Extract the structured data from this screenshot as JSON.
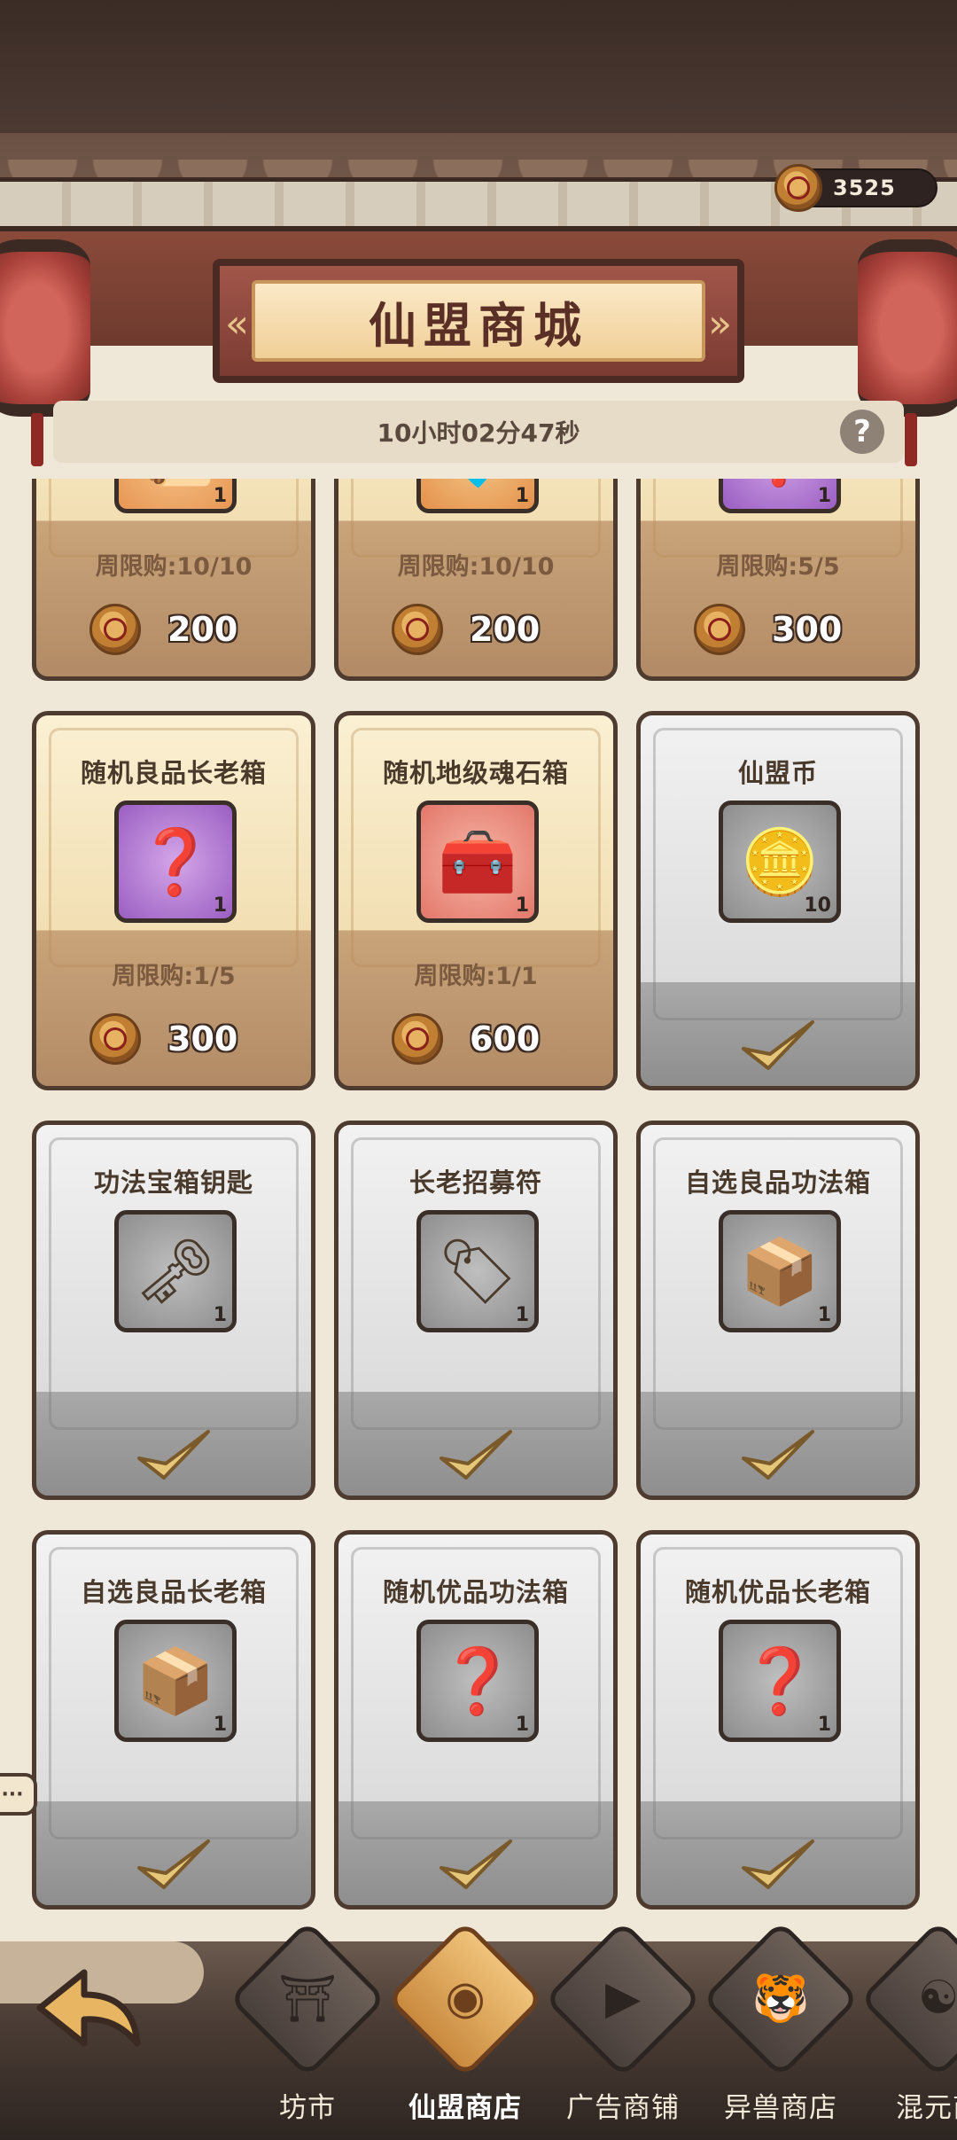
{
  "header": {
    "currency_amount": "3525",
    "title": "仙盟商城",
    "timer": "10小时02分47秒"
  },
  "shop": {
    "items": [
      {
        "name": "",
        "limit": "周限购:10/10",
        "price": "200",
        "qty": "1",
        "icon": "scroll-item-icon",
        "state": "available",
        "color": "orange"
      },
      {
        "name": "",
        "limit": "周限购:10/10",
        "price": "200",
        "qty": "1",
        "icon": "spirit-stone-icon",
        "state": "available",
        "color": "blue"
      },
      {
        "name": "",
        "limit": "周限购:5/5",
        "price": "300",
        "qty": "1",
        "icon": "mystery-chest-icon",
        "state": "available",
        "color": "purple"
      },
      {
        "name": "随机良品长老箱",
        "limit": "周限购:1/5",
        "price": "300",
        "qty": "1",
        "icon": "mystery-chest-icon",
        "state": "available",
        "color": "purple"
      },
      {
        "name": "随机地级魂石箱",
        "limit": "周限购:1/1",
        "price": "600",
        "qty": "1",
        "icon": "soul-stone-chest-icon",
        "state": "available",
        "color": "pink"
      },
      {
        "name": "仙盟币",
        "limit": "",
        "price": "",
        "qty": "10",
        "icon": "alliance-coin-icon",
        "state": "sold-out",
        "color": "silver"
      },
      {
        "name": "功法宝箱钥匙",
        "limit": "",
        "price": "",
        "qty": "1",
        "icon": "key-icon",
        "state": "sold-out",
        "color": "silver"
      },
      {
        "name": "长老招募符",
        "limit": "",
        "price": "",
        "qty": "1",
        "icon": "recruit-talisman-icon",
        "state": "sold-out",
        "color": "silver"
      },
      {
        "name": "自选良品功法箱",
        "limit": "",
        "price": "",
        "qty": "1",
        "icon": "technique-chest-icon",
        "state": "sold-out",
        "color": "silver"
      },
      {
        "name": "自选良品长老箱",
        "limit": "",
        "price": "",
        "qty": "1",
        "icon": "elder-chest-icon",
        "state": "sold-out",
        "color": "silver"
      },
      {
        "name": "随机优品功法箱",
        "limit": "",
        "price": "",
        "qty": "1",
        "icon": "mystery-chest-icon",
        "state": "sold-out",
        "color": "silver"
      },
      {
        "name": "随机优品长老箱",
        "limit": "",
        "price": "",
        "qty": "1",
        "icon": "mystery-chest-icon",
        "state": "sold-out",
        "color": "silver"
      }
    ]
  },
  "nav": {
    "items": [
      {
        "label": "坊市",
        "icon": "market-icon",
        "active": false
      },
      {
        "label": "仙盟商店",
        "icon": "alliance-shop-icon",
        "active": true
      },
      {
        "label": "广告商铺",
        "icon": "ad-shop-icon",
        "active": false
      },
      {
        "label": "异兽商店",
        "icon": "beast-shop-icon",
        "active": false
      },
      {
        "label": "混元商",
        "icon": "hunyuan-shop-icon",
        "active": false
      }
    ]
  },
  "colors": {
    "accent_gold": "#c98a3e",
    "plaque_red": "#a2564a",
    "price_text": "#ffffff"
  }
}
